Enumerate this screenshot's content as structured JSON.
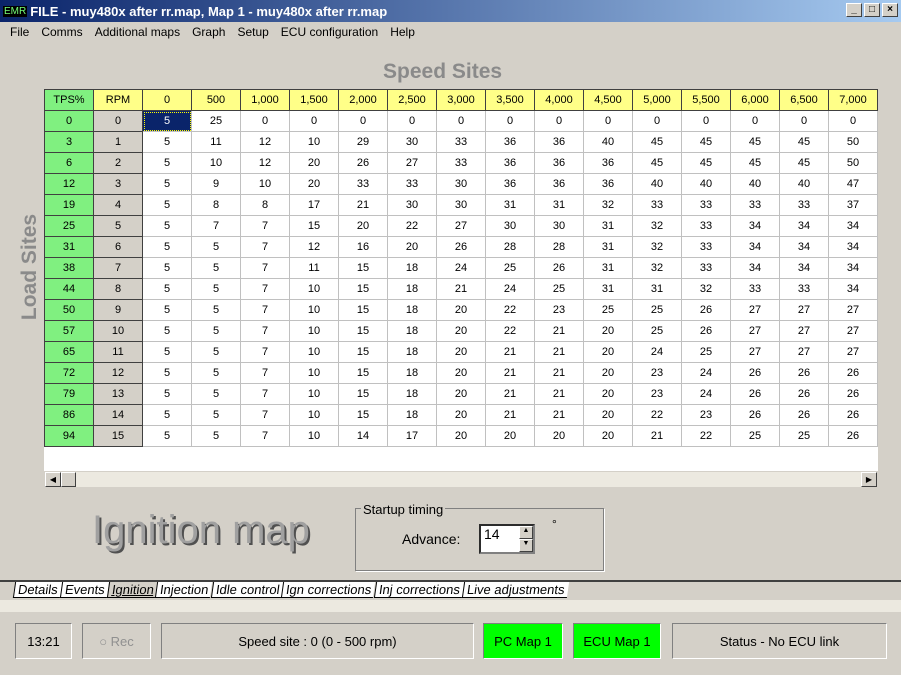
{
  "window": {
    "logo": "EMR",
    "title": "FILE - muy480x after rr.map,  Map 1 - muy480x after rr.map",
    "minimize": "_",
    "maximize": "□",
    "close": "×"
  },
  "menu": [
    "File",
    "Comms",
    "Additional maps",
    "Graph",
    "Setup",
    "ECU configuration",
    "Help"
  ],
  "speed_sites_label": "Speed Sites",
  "load_sites_label": "Load Sites",
  "table": {
    "tps_header": "TPS%",
    "rpm_header": "RPM",
    "columns": [
      "0",
      "500",
      "1,000",
      "1,500",
      "2,000",
      "2,500",
      "3,000",
      "3,500",
      "4,000",
      "4,500",
      "5,000",
      "5,500",
      "6,000",
      "6,500",
      "7,000"
    ],
    "tps": [
      "0",
      "3",
      "6",
      "12",
      "19",
      "25",
      "31",
      "38",
      "44",
      "50",
      "57",
      "65",
      "72",
      "79",
      "86",
      "94"
    ],
    "rpm": [
      "0",
      "1",
      "2",
      "3",
      "4",
      "5",
      "6",
      "7",
      "8",
      "9",
      "10",
      "11",
      "12",
      "13",
      "14",
      "15"
    ],
    "selected": [
      0,
      0
    ],
    "values": [
      [
        5,
        25,
        0,
        0,
        0,
        0,
        0,
        0,
        0,
        0,
        0,
        0,
        0,
        0,
        0
      ],
      [
        5,
        11,
        12,
        10,
        29,
        30,
        33,
        36,
        36,
        40,
        45,
        45,
        45,
        45,
        50
      ],
      [
        5,
        10,
        12,
        20,
        26,
        27,
        33,
        36,
        36,
        36,
        45,
        45,
        45,
        45,
        50
      ],
      [
        5,
        9,
        10,
        20,
        33,
        33,
        30,
        36,
        36,
        36,
        40,
        40,
        40,
        40,
        47
      ],
      [
        5,
        8,
        8,
        17,
        21,
        30,
        30,
        31,
        31,
        32,
        33,
        33,
        33,
        33,
        37
      ],
      [
        5,
        7,
        7,
        15,
        20,
        22,
        27,
        30,
        30,
        31,
        32,
        33,
        34,
        34,
        34
      ],
      [
        5,
        5,
        7,
        12,
        16,
        20,
        26,
        28,
        28,
        31,
        32,
        33,
        34,
        34,
        34
      ],
      [
        5,
        5,
        7,
        11,
        15,
        18,
        24,
        25,
        26,
        31,
        32,
        33,
        34,
        34,
        34
      ],
      [
        5,
        5,
        7,
        10,
        15,
        18,
        21,
        24,
        25,
        31,
        31,
        32,
        33,
        33,
        34
      ],
      [
        5,
        5,
        7,
        10,
        15,
        18,
        20,
        22,
        23,
        25,
        25,
        26,
        27,
        27,
        27
      ],
      [
        5,
        5,
        7,
        10,
        15,
        18,
        20,
        22,
        21,
        20,
        25,
        26,
        27,
        27,
        27
      ],
      [
        5,
        5,
        7,
        10,
        15,
        18,
        20,
        21,
        21,
        20,
        24,
        25,
        27,
        27,
        27
      ],
      [
        5,
        5,
        7,
        10,
        15,
        18,
        20,
        21,
        21,
        20,
        23,
        24,
        26,
        26,
        26
      ],
      [
        5,
        5,
        7,
        10,
        15,
        18,
        20,
        21,
        21,
        20,
        23,
        24,
        26,
        26,
        26
      ],
      [
        5,
        5,
        7,
        10,
        15,
        18,
        20,
        21,
        21,
        20,
        22,
        23,
        26,
        26,
        26
      ],
      [
        5,
        5,
        7,
        10,
        14,
        17,
        20,
        20,
        20,
        20,
        21,
        22,
        25,
        25,
        26
      ]
    ]
  },
  "map_title": "Ignition map",
  "startup": {
    "legend": "Startup timing",
    "label": "Advance:",
    "value": "14",
    "unit": "°"
  },
  "tabs": [
    "Details",
    "Events",
    "Ignition",
    "Injection",
    "Idle control",
    "Ign corrections",
    "Inj corrections",
    "Live adjustments"
  ],
  "active_tab": "Ignition",
  "statusbar": {
    "time": "13:21",
    "rec": "Rec",
    "speed_site": "Speed site : 0 (0 - 500 rpm)",
    "pc_map": "PC Map 1",
    "ecu_map": "ECU Map 1",
    "status": "Status - No ECU link"
  },
  "colors": {
    "tps": "#80f080",
    "header": "#ffff88",
    "map_active": "#00ff00",
    "selected": "#0a246a"
  }
}
